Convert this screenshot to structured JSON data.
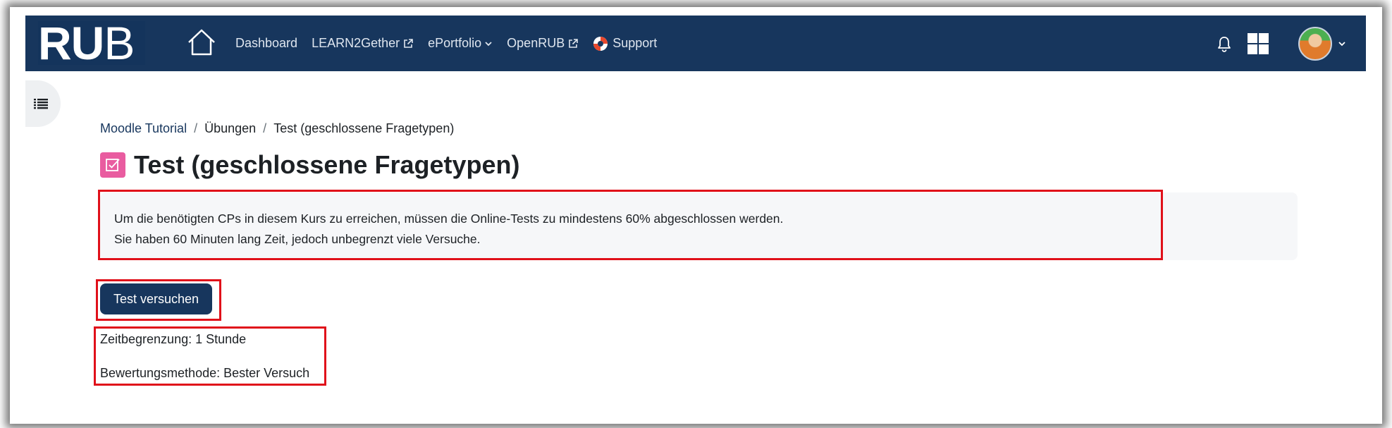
{
  "navbar": {
    "logo": {
      "bold": "RU",
      "light": "B"
    },
    "items": [
      {
        "label": "Dashboard"
      },
      {
        "label": "LEARN2Gether"
      },
      {
        "label": "ePortfolio"
      },
      {
        "label": "OpenRUB"
      },
      {
        "label": "Support"
      }
    ],
    "icons": [
      "home-icon",
      "external-link-icon",
      "chevron-down-icon",
      "lifebuoy-icon",
      "bell-icon",
      "grid-icon",
      "avatar",
      "chevron-down-icon"
    ]
  },
  "drawer": {
    "icon": "list-icon"
  },
  "breadcrumb": [
    {
      "label": "Moodle Tutorial"
    },
    {
      "label": "Übungen"
    },
    {
      "label": "Test (geschlossene Fragetypen)"
    }
  ],
  "breadcrumb_separator": "/",
  "page": {
    "title": "Test (geschlossene Fragetypen)",
    "icon": "quiz-icon",
    "intro": [
      "Um die benötigten CPs in diesem Kurs zu erreichen, müssen die Online-Tests zu mindestens 60% abgeschlossen werden.",
      "Sie haben 60 Minuten lang Zeit, jedoch unbegrenzt viele Versuche."
    ],
    "attempt_button": "Test versuchen",
    "time_limit": "Zeitbegrenzung: 1 Stunde",
    "grading_method": "Bewertungsmethode: Bester Versuch"
  },
  "colors": {
    "navbar": "#17365d",
    "highlight": "#e0101a",
    "quiz_icon": "#e95ca0"
  }
}
